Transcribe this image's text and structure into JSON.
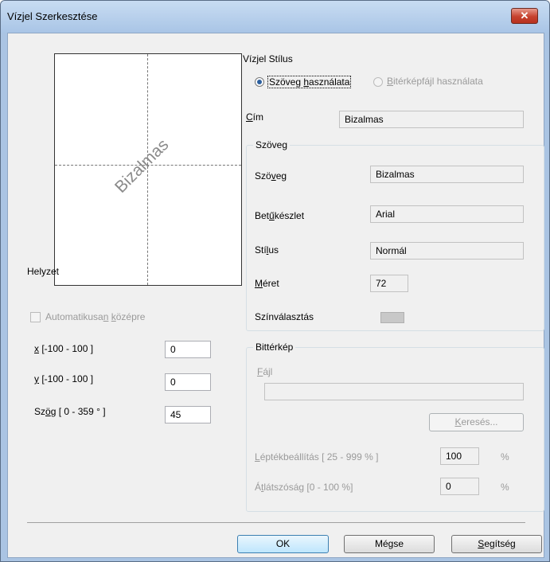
{
  "window": {
    "title": "Vízjel Szerkesztése",
    "close_glyph": "✕"
  },
  "preview": {
    "watermark_text": "Bizalmas"
  },
  "position": {
    "heading": "Helyzet",
    "auto_center_label": "Automatikusan középre",
    "x_label": "x [-100 - 100 ]",
    "x_value": "0",
    "y_label": "y [-100 - 100 ]",
    "y_value": "0",
    "angle_label": "Szög [ 0 - 359 ° ]",
    "angle_value": "45"
  },
  "style": {
    "heading": "Vízjel Stílus",
    "text_option": "Szöveg használata",
    "bitmap_option": "Bitérképfájl használata",
    "selected": "text"
  },
  "title_field": {
    "label": "Cím",
    "value": "Bizalmas"
  },
  "text_group": {
    "heading": "Szöveg",
    "text_label": "Szöveg",
    "text_value": "Bizalmas",
    "font_label": "Betűkészlet",
    "font_value": "Arial",
    "style_label": "Stílus",
    "style_value": "Normál",
    "size_label": "Méret",
    "size_value": "72",
    "color_label": "Színválasztás",
    "color_value": "#c8c8c8"
  },
  "bitmap_group": {
    "heading": "Bittérkép",
    "file_label": "Fájl",
    "file_value": "",
    "browse_button": "Keresés...",
    "scale_label": "Léptékbeállítás [ 25 - 999 % ]",
    "scale_value": "100",
    "scale_unit": "%",
    "transparency_label": "Átlátszóság [0 - 100 %]",
    "transparency_value": "0",
    "transparency_unit": "%"
  },
  "buttons": {
    "ok": "OK",
    "cancel": "Mégse",
    "help": "Segítség"
  }
}
